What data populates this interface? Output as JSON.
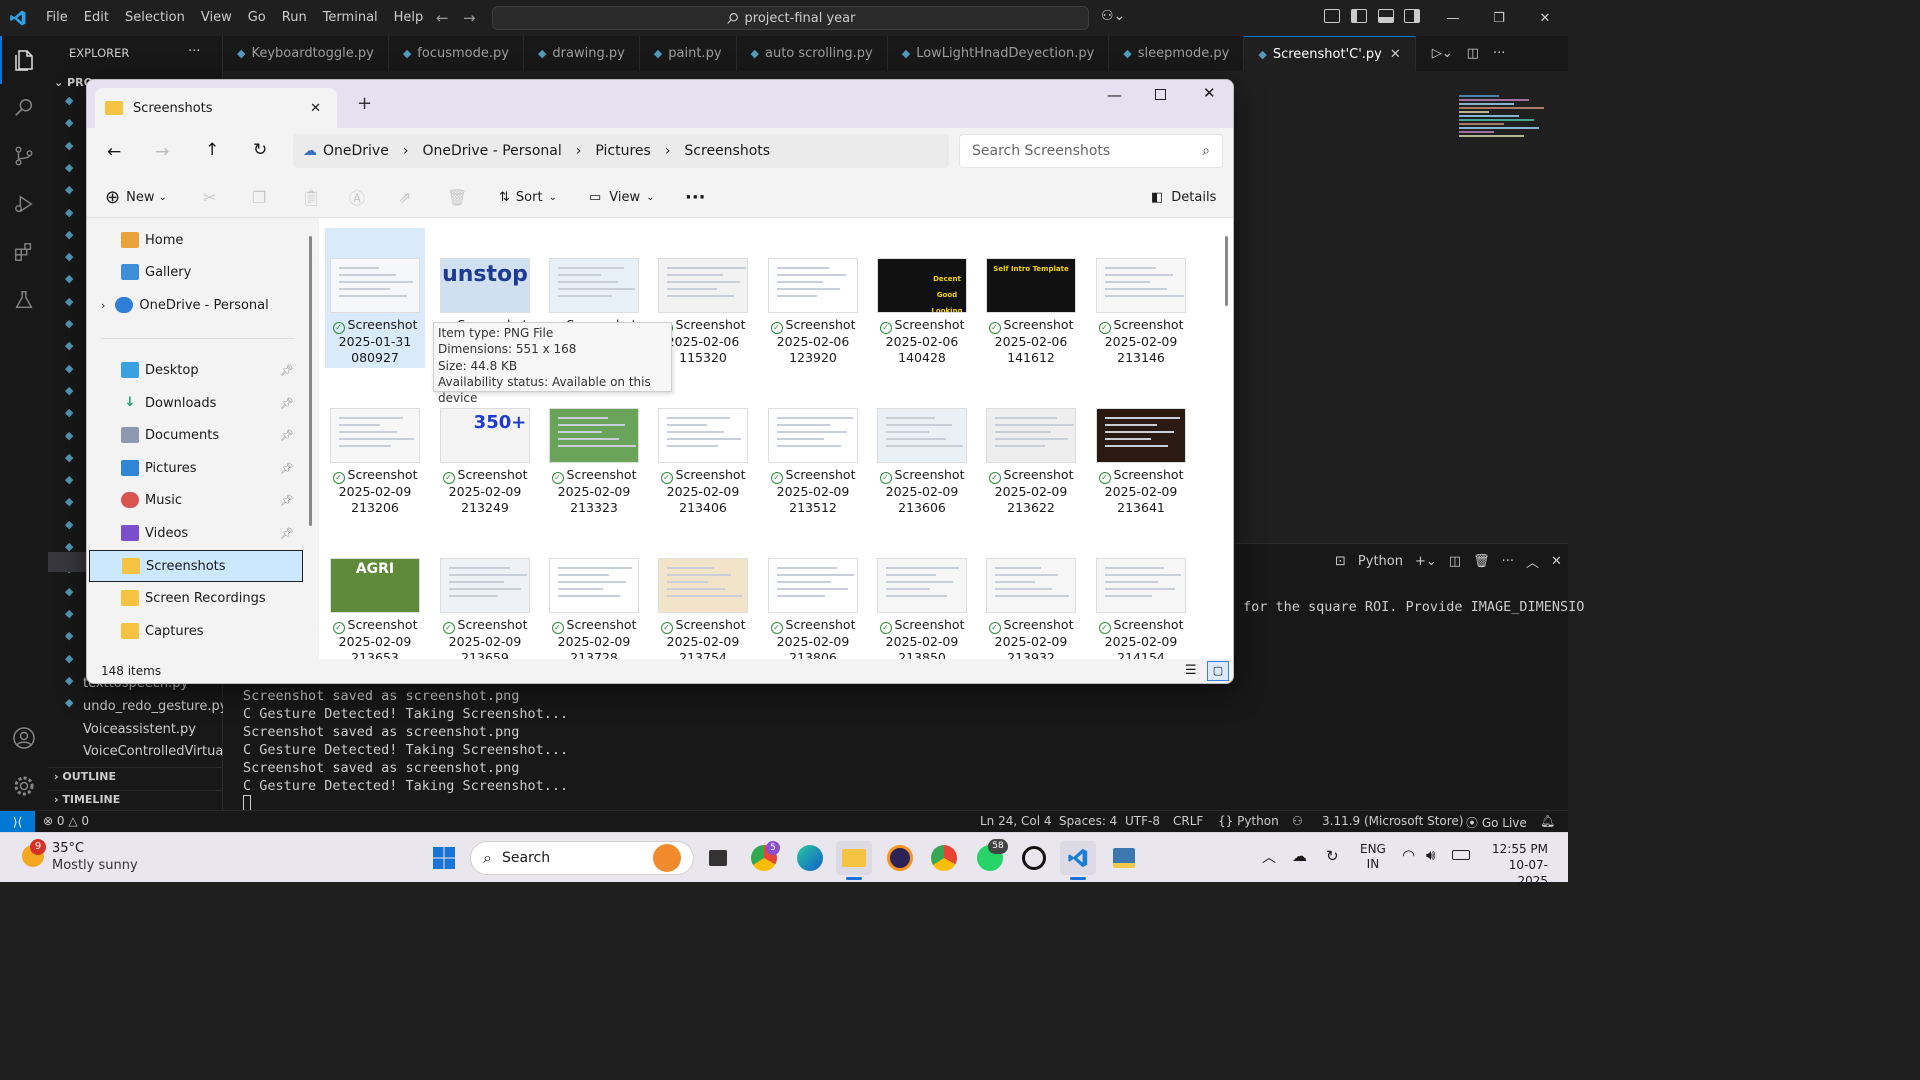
{
  "vscode": {
    "menu": [
      "File",
      "Edit",
      "Selection",
      "View",
      "Go",
      "Run",
      "Terminal",
      "Help"
    ],
    "search_text": "project-final year",
    "explorer_title": "EXPLORER",
    "explorer_root": "PRO",
    "tabs": [
      "Keyboardtoggle.py",
      "focusmode.py",
      "drawing.py",
      "paint.py",
      "auto scrolling.py",
      "LowLightHnadDeyection.py",
      "sleepmode.py",
      "Screenshot'C'.py"
    ],
    "files_bottom": [
      "texttospeech.py",
      "undo_redo_gesture.py",
      "Voiceassistent.py",
      "VoiceControlledVirtua..."
    ],
    "outline_label": "OUTLINE",
    "timeline_label": "TIMELINE",
    "panel_python_label": "Python",
    "panel_snippet": "for the square ROI. Provide IMAGE_DIMENSIO",
    "terminal_lines": [
      "Screenshot saved as screenshot.png",
      "C Gesture Detected! Taking Screenshot...",
      "Screenshot saved as screenshot.png",
      "C Gesture Detected! Taking Screenshot...",
      "Screenshot saved as screenshot.png",
      "C Gesture Detected! Taking Screenshot..."
    ],
    "status": {
      "errors": "0",
      "warnings": "0",
      "position": "Ln 24, Col 4",
      "spaces": "Spaces: 4",
      "encoding": "UTF-8",
      "eol": "CRLF",
      "language": "Python",
      "interpreter": "3.11.9 (Microsoft Store)",
      "golive": "Go Live"
    }
  },
  "explorer": {
    "tab_title": "Screenshots",
    "breadcrumb": [
      "OneDrive",
      "OneDrive - Personal",
      "Pictures",
      "Screenshots"
    ],
    "search_placeholder": "Search Screenshots",
    "commands": {
      "new": "New",
      "sort": "Sort",
      "view": "View",
      "details": "Details"
    },
    "nav_top": [
      "Home",
      "Gallery",
      "OneDrive - Personal"
    ],
    "nav_quick": [
      "Desktop",
      "Downloads",
      "Documents",
      "Pictures",
      "Music",
      "Videos",
      "Screenshots",
      "Screen Recordings",
      "Captures"
    ],
    "item_count": "148 items",
    "tooltip": [
      "Item type: PNG File",
      "Dimensions: 551 x 168",
      "Size: 44.8 KB",
      "Availability status: Available on this device"
    ],
    "files": [
      {
        "name": "Screenshot",
        "date": "2025-01-31",
        "time": "080927"
      },
      {
        "name": "Screenshot",
        "date": "",
        "time": ""
      },
      {
        "name": "Screenshot",
        "date": "",
        "time": ""
      },
      {
        "name": "Screenshot",
        "date": "2025-02-06",
        "time": "115320"
      },
      {
        "name": "Screenshot",
        "date": "2025-02-06",
        "time": "123920"
      },
      {
        "name": "Screenshot",
        "date": "2025-02-06",
        "time": "140428"
      },
      {
        "name": "Screenshot",
        "date": "2025-02-06",
        "time": "141612"
      },
      {
        "name": "Screenshot",
        "date": "2025-02-09",
        "time": "213146"
      },
      {
        "name": "Screenshot",
        "date": "2025-02-09",
        "time": "213206"
      },
      {
        "name": "Screenshot",
        "date": "2025-02-09",
        "time": "213249"
      },
      {
        "name": "Screenshot",
        "date": "2025-02-09",
        "time": "213323"
      },
      {
        "name": "Screenshot",
        "date": "2025-02-09",
        "time": "213406"
      },
      {
        "name": "Screenshot",
        "date": "2025-02-09",
        "time": "213512"
      },
      {
        "name": "Screenshot",
        "date": "2025-02-09",
        "time": "213606"
      },
      {
        "name": "Screenshot",
        "date": "2025-02-09",
        "time": "213622"
      },
      {
        "name": "Screenshot",
        "date": "2025-02-09",
        "time": "213641"
      },
      {
        "name": "Screenshot",
        "date": "2025-02-09",
        "time": "213653"
      },
      {
        "name": "Screenshot",
        "date": "2025-02-09",
        "time": "213659"
      },
      {
        "name": "Screenshot",
        "date": "2025-02-09",
        "time": "213728"
      },
      {
        "name": "Screenshot",
        "date": "2025-02-09",
        "time": "213754"
      },
      {
        "name": "Screenshot",
        "date": "2025-02-09",
        "time": "213806"
      },
      {
        "name": "Screenshot",
        "date": "2025-02-09",
        "time": "213850"
      },
      {
        "name": "Screenshot",
        "date": "2025-02-09",
        "time": "213932"
      },
      {
        "name": "Screenshot",
        "date": "2025-02-09",
        "time": "214154"
      }
    ],
    "thumb_texts": {
      "unstop": "unstop",
      "decent": "Decent Good Looking",
      "selfintro": "Self Intro Template",
      "agri": "AGRI",
      "n350": "350+"
    }
  },
  "taskbar": {
    "weather_temp": "35°C",
    "weather_desc": "Mostly sunny",
    "weather_badge": "9",
    "search_label": "Search",
    "lang_line1": "ENG",
    "lang_line2": "IN",
    "time": "12:55 PM",
    "date": "10-07-2025",
    "chrome_badge": "5",
    "whatsapp_badge": "58"
  },
  "colors": {
    "accent": "#0078d4",
    "selection": "#cce8ff",
    "folder": "#f5c242"
  }
}
